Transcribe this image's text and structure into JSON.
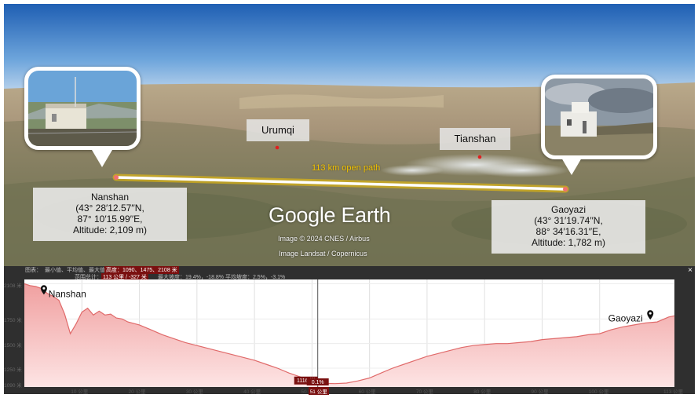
{
  "map": {
    "sites": [
      {
        "name": "Nanshan",
        "coord_lat": "(43° 28′12.57′′N,",
        "coord_lon": "87° 10′15.99′′E,",
        "altitude": "Altitude: 2,109 m)"
      },
      {
        "name": "Gaoyazi",
        "coord_lat": "(43° 31′19.74′′N,",
        "coord_lon": "88° 34′16.31′′E,",
        "altitude": "Altitude: 1,782 m)"
      }
    ],
    "places": [
      "Urumqi",
      "Tianshan"
    ],
    "path_label": "113 km open path",
    "logo": "Google Earth",
    "credit_line1": "Image © 2024 CNES / Airbus",
    "credit_line2": "Image Landsat / Copernicus"
  },
  "profile": {
    "stats_left_label": "图表：",
    "stats_line1": "最小值、平均值、最大值：",
    "stats_highlight1": "高度：1090、1475、2108 米",
    "stats_line2": "范围总计：",
    "stats_highlight2": "113 公里 / -327 米",
    "stats_line3": "最大坡度：19.4%，-18.8%  平均坡度：2.5%，-3.1%",
    "close": "×",
    "cursor_label": "1116 米",
    "cursor_sub": "0.1%",
    "cursor_x_label": "51 公里",
    "start_marker": "Nanshan",
    "end_marker": "Gaoyazi"
  },
  "chart_data": {
    "type": "area",
    "title": "",
    "xlabel": "",
    "ylabel": "",
    "xlim": [
      0,
      113
    ],
    "ylim": [
      1090,
      2120
    ],
    "y_ticks": [
      "2108 米",
      "1750 米",
      "1500 米",
      "1250 米",
      "1090 米"
    ],
    "y_tick_values": [
      2108,
      1750,
      1500,
      1250,
      1090
    ],
    "x_ticks": [
      "10 公里",
      "20 公里",
      "30 公里",
      "40 公里",
      "50 公里",
      "60 公里",
      "70 公里",
      "80 公里",
      "90 公里",
      "100 公里",
      "113 公里"
    ],
    "x_tick_values": [
      10,
      20,
      30,
      40,
      50,
      60,
      70,
      80,
      90,
      100,
      113
    ],
    "series": [
      {
        "x": [
          0,
          1,
          2,
          3,
          4,
          5,
          6,
          7,
          8,
          9,
          10,
          11,
          12,
          13,
          14,
          15,
          16,
          17,
          18,
          20,
          22,
          24,
          26,
          28,
          30,
          32,
          34,
          36,
          38,
          40,
          42,
          44,
          46,
          48,
          50,
          52,
          54,
          56,
          58,
          60,
          62,
          64,
          66,
          68,
          70,
          72,
          74,
          76,
          78,
          80,
          82,
          84,
          86,
          88,
          90,
          92,
          94,
          96,
          98,
          100,
          102,
          104,
          106,
          108,
          110,
          112,
          113
        ],
        "y": [
          2108,
          2090,
          2080,
          2060,
          2010,
          1980,
          1940,
          1800,
          1600,
          1700,
          1820,
          1860,
          1790,
          1830,
          1790,
          1800,
          1760,
          1750,
          1720,
          1690,
          1640,
          1590,
          1550,
          1510,
          1480,
          1450,
          1420,
          1390,
          1360,
          1330,
          1290,
          1250,
          1200,
          1160,
          1116,
          1095,
          1092,
          1098,
          1120,
          1150,
          1200,
          1250,
          1290,
          1330,
          1370,
          1400,
          1430,
          1460,
          1480,
          1490,
          1500,
          1500,
          1510,
          1520,
          1540,
          1550,
          1560,
          1570,
          1590,
          1600,
          1640,
          1670,
          1690,
          1710,
          1720,
          1770,
          1782
        ]
      }
    ],
    "cursor_x": 51,
    "cursor_y": 1116
  },
  "colors": {
    "path": "#ffffff",
    "path_glow": "#f5c400",
    "area_fill": "#f7c9c9",
    "area_line": "#e06a6a",
    "highlight": "#7a1010"
  }
}
